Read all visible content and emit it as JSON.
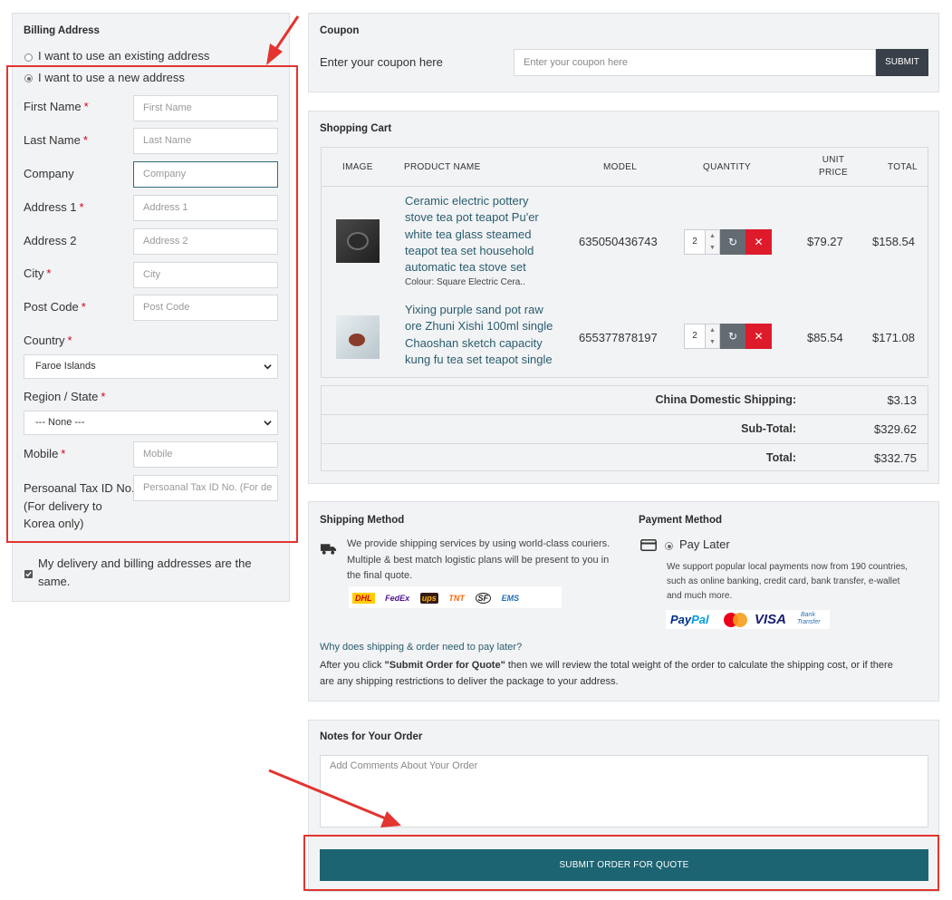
{
  "billing": {
    "title": "Billing Address",
    "option_existing": "I want to use an existing address",
    "option_new": "I want to use a new address",
    "fields": {
      "first_name": {
        "label": "First Name",
        "placeholder": "First Name"
      },
      "last_name": {
        "label": "Last Name",
        "placeholder": "Last Name"
      },
      "company": {
        "label": "Company",
        "placeholder": "Company"
      },
      "address1": {
        "label": "Address 1",
        "placeholder": "Address 1"
      },
      "address2": {
        "label": "Address 2",
        "placeholder": "Address 2"
      },
      "city": {
        "label": "City",
        "placeholder": "City"
      },
      "postcode": {
        "label": "Post Code",
        "placeholder": "Post Code"
      },
      "mobile": {
        "label": "Mobile",
        "placeholder": "Mobile"
      },
      "tax_label_1": "Persoanal Tax ID No.",
      "tax_label_2": "(For delivery to",
      "tax_label_3": "Korea only)",
      "tax_placeholder": "Persoanal Tax ID No. (For de"
    },
    "country_label": "Country",
    "country_value": "Faroe Islands",
    "region_label": "Region / State",
    "region_value": "--- None ---",
    "same_address_1": "My delivery and billing addresses are the",
    "same_address_2": "same.",
    "required_mark": "*"
  },
  "coupon": {
    "title": "Coupon",
    "label": "Enter your coupon here",
    "placeholder": "Enter your coupon here",
    "submit": "SUBMIT"
  },
  "cart": {
    "title": "Shopping Cart",
    "headers": {
      "image": "IMAGE",
      "product": "PRODUCT NAME",
      "model": "MODEL",
      "quantity": "QUANTITY",
      "unit1": "UNIT",
      "unit2": "PRICE",
      "total": "TOTAL"
    },
    "items": [
      {
        "name_lines": [
          "Ceramic electric pottery",
          "stove tea pot teapot Pu'er",
          "white tea glass steamed",
          "teapot tea set household",
          "automatic tea stove set"
        ],
        "option": "Colour: Square Electric Cera..",
        "model": "635050436743",
        "qty": "2",
        "unit_price": "$79.27",
        "total": "$158.54"
      },
      {
        "name_lines": [
          "Yixing purple sand pot raw",
          "ore Zhuni Xishi 100ml single",
          "Chaoshan sketch capacity",
          "kung fu tea set teapot single"
        ],
        "option": "",
        "model": "655377878197",
        "qty": "2",
        "unit_price": "$85.54",
        "total": "$171.08"
      }
    ],
    "totals": [
      {
        "label": "China Domestic Shipping:",
        "value": "$3.13"
      },
      {
        "label": "Sub-Total:",
        "value": "$329.62"
      },
      {
        "label": "Total:",
        "value": "$332.75"
      }
    ]
  },
  "shipping": {
    "title": "Shipping Method",
    "desc_1": "We provide shipping services by using world-class couriers.",
    "desc_2": "Multiple & best match logistic plans will be present to you in",
    "desc_3": "the final quote.",
    "carriers": [
      "DHL",
      "FedEx",
      "ups",
      "TNT",
      "SF",
      "EMS"
    ]
  },
  "payment": {
    "title": "Payment Method",
    "option": "Pay Later",
    "desc_1": "We support popular local payments now from 190 countries,",
    "desc_2": "such as online banking, credit card, bank transfer, e-wallet",
    "desc_3": "and much more.",
    "logos": {
      "paypal_a": "Pay",
      "paypal_b": "Pal",
      "visa": "VISA",
      "bank_1": "Bank",
      "bank_2": "Transfer"
    }
  },
  "why": {
    "question": "Why does shipping & order need to pay later?",
    "answer_pre": "After you click ",
    "answer_bold": "\"Submit Order for Quote\"",
    "answer_post_1": " then we will review the total weight of the order to calculate the shipping cost, or if there",
    "answer_post_2": "are any shipping restrictions to deliver the package to your address."
  },
  "notes": {
    "title": "Notes for Your Order",
    "placeholder": "Add Comments About Your Order"
  },
  "submit_order": "SUBMIT ORDER FOR QUOTE",
  "colors": {
    "accent": "#1d6472",
    "annotation": "#e3342f",
    "danger": "#de1b2b",
    "panel": "#f2f3f5"
  }
}
